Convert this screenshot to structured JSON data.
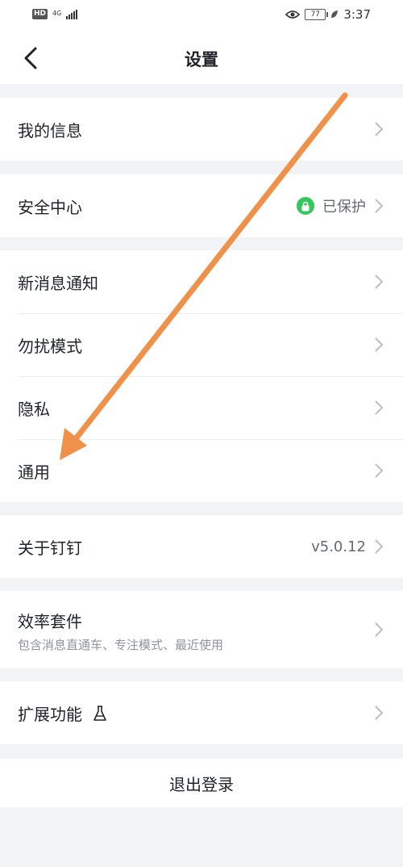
{
  "status_bar": {
    "hd_badge": "HD",
    "network": "4G",
    "battery": "77",
    "time": "3:37"
  },
  "nav": {
    "title": "设置"
  },
  "groups": [
    {
      "rows": [
        {
          "label": "我的信息"
        }
      ]
    },
    {
      "rows": [
        {
          "label": "安全中心",
          "value": "已保护"
        }
      ]
    },
    {
      "rows": [
        {
          "label": "新消息通知"
        },
        {
          "label": "勿扰模式"
        },
        {
          "label": "隐私"
        },
        {
          "label": "通用"
        }
      ]
    },
    {
      "rows": [
        {
          "label": "关于钉钉",
          "value": "v5.0.12"
        }
      ]
    },
    {
      "rows": [
        {
          "label": "效率套件",
          "sublabel": "包含消息直通车、专注模式、最近使用"
        }
      ]
    },
    {
      "rows": [
        {
          "label": "扩展功能"
        }
      ]
    }
  ],
  "logout_label": "退出登录",
  "colors": {
    "background": "#f2f3f5",
    "secure_green": "#34c759",
    "annotation_arrow": "#f0914a"
  }
}
